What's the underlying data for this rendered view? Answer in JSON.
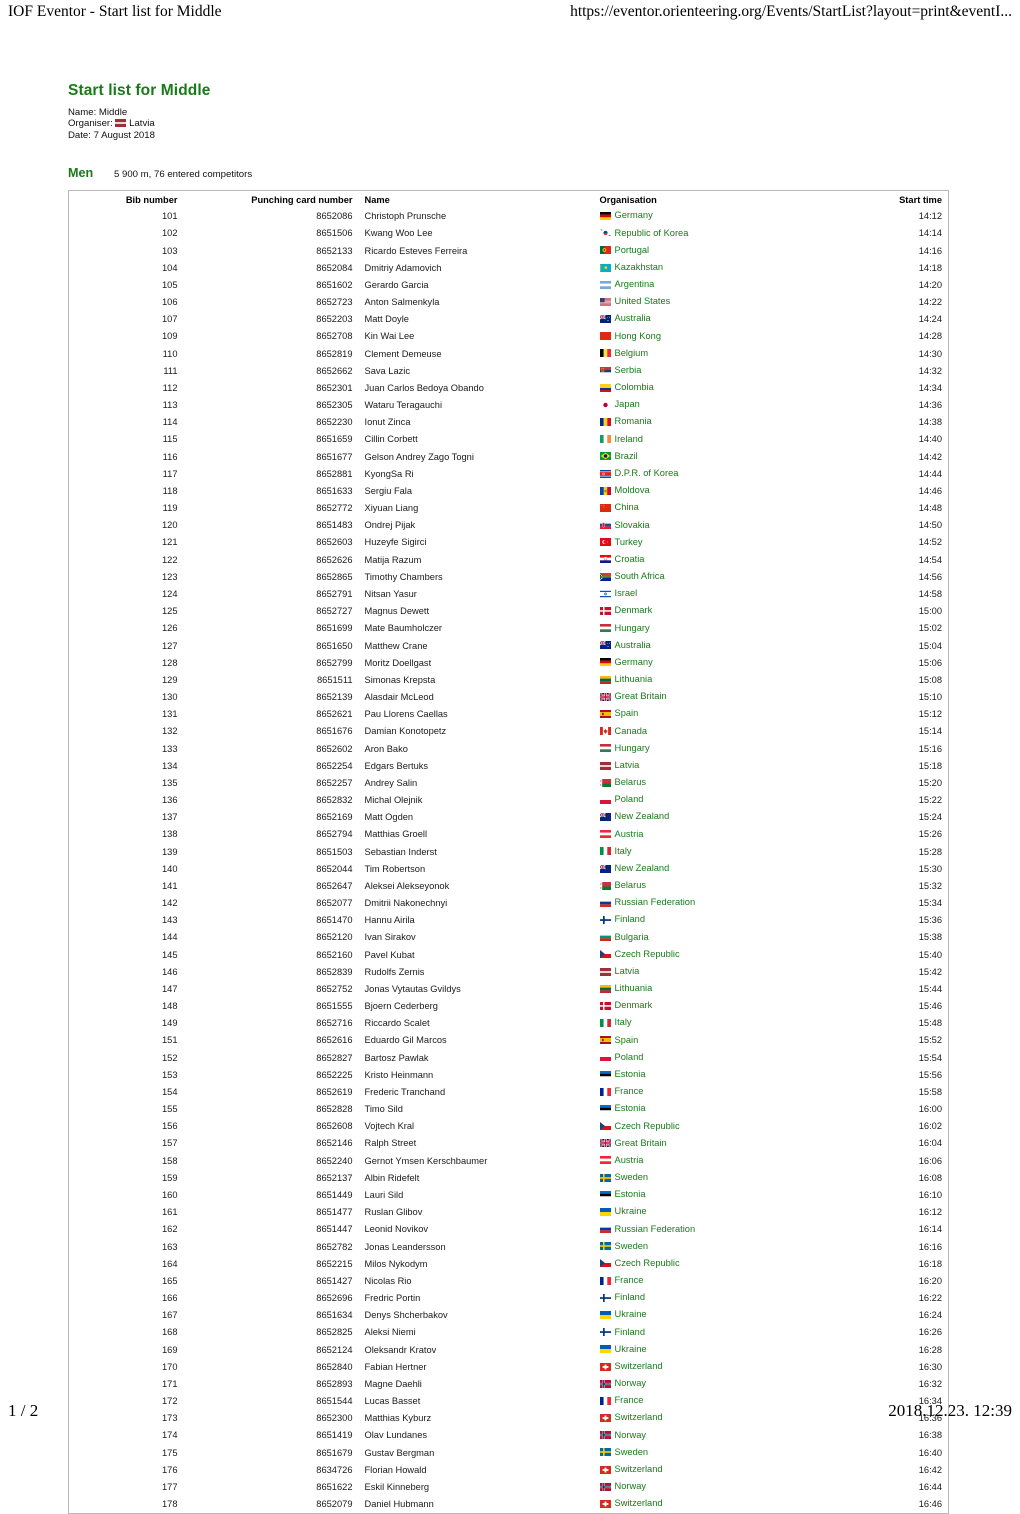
{
  "print_header": {
    "left": "IOF Eventor - Start list for Middle",
    "right": "https://eventor.orienteering.org/Events/StartList?layout=print&eventI..."
  },
  "print_footer": {
    "page": "1 / 2",
    "timestamp": "2018.12.23. 12:39"
  },
  "document": {
    "title": "Start list for Middle",
    "title_color": "#1a7a1a",
    "meta": {
      "name_label": "Name: Middle",
      "organiser_label": "Organiser:",
      "organiser_value": "Latvia",
      "organiser_flag": "flag-lv",
      "date_label": "Date: 7 August 2018"
    }
  },
  "class_block": {
    "class_name": "Men",
    "class_info": "5 900 m, 76 entered competitors"
  },
  "table": {
    "columns": [
      "Bib number",
      "Punching card number",
      "Name",
      "Organisation",
      "Start time"
    ],
    "rows": [
      {
        "bib": "101",
        "card": "8652086",
        "name": "Christoph Prunsche",
        "org": "Germany",
        "flag": "flag-de",
        "time": "14:12"
      },
      {
        "bib": "102",
        "card": "8651506",
        "name": "Kwang Woo Lee",
        "org": "Republic of Korea",
        "flag": "flag-kr",
        "time": "14:14"
      },
      {
        "bib": "103",
        "card": "8652133",
        "name": "Ricardo Esteves Ferreira",
        "org": "Portugal",
        "flag": "flag-pt",
        "time": "14:16"
      },
      {
        "bib": "104",
        "card": "8652084",
        "name": "Dmitriy Adamovich",
        "org": "Kazakhstan",
        "flag": "flag-kz",
        "time": "14:18"
      },
      {
        "bib": "105",
        "card": "8651602",
        "name": "Gerardo Garcia",
        "org": "Argentina",
        "flag": "flag-ar",
        "time": "14:20"
      },
      {
        "bib": "106",
        "card": "8652723",
        "name": "Anton Salmenkyla",
        "org": "United States",
        "flag": "flag-us",
        "time": "14:22"
      },
      {
        "bib": "107",
        "card": "8652203",
        "name": "Matt Doyle",
        "org": "Australia",
        "flag": "flag-au",
        "time": "14:24"
      },
      {
        "bib": "109",
        "card": "8652708",
        "name": "Kin Wai Lee",
        "org": "Hong Kong",
        "flag": "flag-hk",
        "time": "14:28"
      },
      {
        "bib": "110",
        "card": "8652819",
        "name": "Clement Demeuse",
        "org": "Belgium",
        "flag": "flag-be",
        "time": "14:30"
      },
      {
        "bib": "111",
        "card": "8652662",
        "name": "Sava Lazic",
        "org": "Serbia",
        "flag": "flag-rs",
        "time": "14:32"
      },
      {
        "bib": "112",
        "card": "8652301",
        "name": "Juan Carlos Bedoya Obando",
        "org": "Colombia",
        "flag": "flag-co",
        "time": "14:34"
      },
      {
        "bib": "113",
        "card": "8652305",
        "name": "Wataru Teragauchi",
        "org": "Japan",
        "flag": "flag-jp",
        "time": "14:36"
      },
      {
        "bib": "114",
        "card": "8652230",
        "name": "Ionut Zinca",
        "org": "Romania",
        "flag": "flag-ro",
        "time": "14:38"
      },
      {
        "bib": "115",
        "card": "8651659",
        "name": "Cillin Corbett",
        "org": "Ireland",
        "flag": "flag-ie",
        "time": "14:40"
      },
      {
        "bib": "116",
        "card": "8651677",
        "name": "Gelson Andrey Zago Togni",
        "org": "Brazil",
        "flag": "flag-br",
        "time": "14:42"
      },
      {
        "bib": "117",
        "card": "8652881",
        "name": "KyongSa Ri",
        "org": "D.P.R. of Korea",
        "flag": "flag-kp",
        "time": "14:44"
      },
      {
        "bib": "118",
        "card": "8651633",
        "name": "Sergiu Fala",
        "org": "Moldova",
        "flag": "flag-md",
        "time": "14:46"
      },
      {
        "bib": "119",
        "card": "8652772",
        "name": "Xiyuan Liang",
        "org": "China",
        "flag": "flag-cn",
        "time": "14:48"
      },
      {
        "bib": "120",
        "card": "8651483",
        "name": "Ondrej Pijak",
        "org": "Slovakia",
        "flag": "flag-sk",
        "time": "14:50"
      },
      {
        "bib": "121",
        "card": "8652603",
        "name": "Huzeyfe Sigirci",
        "org": "Turkey",
        "flag": "flag-tr",
        "time": "14:52"
      },
      {
        "bib": "122",
        "card": "8652626",
        "name": "Matija Razum",
        "org": "Croatia",
        "flag": "flag-hr",
        "time": "14:54"
      },
      {
        "bib": "123",
        "card": "8652865",
        "name": "Timothy Chambers",
        "org": "South Africa",
        "flag": "flag-za",
        "time": "14:56"
      },
      {
        "bib": "124",
        "card": "8652791",
        "name": "Nitsan Yasur",
        "org": "Israel",
        "flag": "flag-il",
        "time": "14:58"
      },
      {
        "bib": "125",
        "card": "8652727",
        "name": "Magnus Dewett",
        "org": "Denmark",
        "flag": "flag-dk",
        "time": "15:00"
      },
      {
        "bib": "126",
        "card": "8651699",
        "name": "Mate Baumholczer",
        "org": "Hungary",
        "flag": "flag-hu",
        "time": "15:02"
      },
      {
        "bib": "127",
        "card": "8651650",
        "name": "Matthew Crane",
        "org": "Australia",
        "flag": "flag-au",
        "time": "15:04"
      },
      {
        "bib": "128",
        "card": "8652799",
        "name": "Moritz Doellgast",
        "org": "Germany",
        "flag": "flag-de",
        "time": "15:06"
      },
      {
        "bib": "129",
        "card": "8651511",
        "name": "Simonas Krepsta",
        "org": "Lithuania",
        "flag": "flag-lt",
        "time": "15:08"
      },
      {
        "bib": "130",
        "card": "8652139",
        "name": "Alasdair McLeod",
        "org": "Great Britain",
        "flag": "flag-gb",
        "time": "15:10"
      },
      {
        "bib": "131",
        "card": "8652621",
        "name": "Pau Llorens Caellas",
        "org": "Spain",
        "flag": "flag-es",
        "time": "15:12"
      },
      {
        "bib": "132",
        "card": "8651676",
        "name": "Damian Konotopetz",
        "org": "Canada",
        "flag": "flag-ca",
        "time": "15:14"
      },
      {
        "bib": "133",
        "card": "8652602",
        "name": "Aron Bako",
        "org": "Hungary",
        "flag": "flag-hu",
        "time": "15:16"
      },
      {
        "bib": "134",
        "card": "8652254",
        "name": "Edgars Bertuks",
        "org": "Latvia",
        "flag": "flag-lv",
        "time": "15:18"
      },
      {
        "bib": "135",
        "card": "8652257",
        "name": "Andrey Salin",
        "org": "Belarus",
        "flag": "flag-by",
        "time": "15:20"
      },
      {
        "bib": "136",
        "card": "8652832",
        "name": "Michal Olejnik",
        "org": "Poland",
        "flag": "flag-pl",
        "time": "15:22"
      },
      {
        "bib": "137",
        "card": "8652169",
        "name": "Matt Ogden",
        "org": "New Zealand",
        "flag": "flag-nz",
        "time": "15:24"
      },
      {
        "bib": "138",
        "card": "8652794",
        "name": "Matthias Groell",
        "org": "Austria",
        "flag": "flag-at",
        "time": "15:26"
      },
      {
        "bib": "139",
        "card": "8651503",
        "name": "Sebastian Inderst",
        "org": "Italy",
        "flag": "flag-it",
        "time": "15:28"
      },
      {
        "bib": "140",
        "card": "8652044",
        "name": "Tim Robertson",
        "org": "New Zealand",
        "flag": "flag-nz",
        "time": "15:30"
      },
      {
        "bib": "141",
        "card": "8652647",
        "name": "Aleksei Alekseyonok",
        "org": "Belarus",
        "flag": "flag-by",
        "time": "15:32"
      },
      {
        "bib": "142",
        "card": "8652077",
        "name": "Dmitrii Nakonechnyi",
        "org": "Russian Federation",
        "flag": "flag-ru",
        "time": "15:34"
      },
      {
        "bib": "143",
        "card": "8651470",
        "name": "Hannu Airila",
        "org": "Finland",
        "flag": "flag-fi",
        "time": "15:36"
      },
      {
        "bib": "144",
        "card": "8652120",
        "name": "Ivan Sirakov",
        "org": "Bulgaria",
        "flag": "flag-bg",
        "time": "15:38"
      },
      {
        "bib": "145",
        "card": "8652160",
        "name": "Pavel Kubat",
        "org": "Czech Republic",
        "flag": "flag-cz",
        "time": "15:40"
      },
      {
        "bib": "146",
        "card": "8652839",
        "name": "Rudolfs Zernis",
        "org": "Latvia",
        "flag": "flag-lv",
        "time": "15:42"
      },
      {
        "bib": "147",
        "card": "8652752",
        "name": "Jonas Vytautas Gvildys",
        "org": "Lithuania",
        "flag": "flag-lt",
        "time": "15:44"
      },
      {
        "bib": "148",
        "card": "8651555",
        "name": "Bjoern Cederberg",
        "org": "Denmark",
        "flag": "flag-dk",
        "time": "15:46"
      },
      {
        "bib": "149",
        "card": "8652716",
        "name": "Riccardo Scalet",
        "org": "Italy",
        "flag": "flag-it",
        "time": "15:48"
      },
      {
        "bib": "151",
        "card": "8652616",
        "name": "Eduardo Gil Marcos",
        "org": "Spain",
        "flag": "flag-es",
        "time": "15:52"
      },
      {
        "bib": "152",
        "card": "8652827",
        "name": "Bartosz Pawlak",
        "org": "Poland",
        "flag": "flag-pl",
        "time": "15:54"
      },
      {
        "bib": "153",
        "card": "8652225",
        "name": "Kristo Heinmann",
        "org": "Estonia",
        "flag": "flag-ee",
        "time": "15:56"
      },
      {
        "bib": "154",
        "card": "8652619",
        "name": "Frederic Tranchand",
        "org": "France",
        "flag": "flag-fr",
        "time": "15:58"
      },
      {
        "bib": "155",
        "card": "8652828",
        "name": "Timo Sild",
        "org": "Estonia",
        "flag": "flag-ee",
        "time": "16:00"
      },
      {
        "bib": "156",
        "card": "8652608",
        "name": "Vojtech Kral",
        "org": "Czech Republic",
        "flag": "flag-cz",
        "time": "16:02"
      },
      {
        "bib": "157",
        "card": "8652146",
        "name": "Ralph Street",
        "org": "Great Britain",
        "flag": "flag-gb",
        "time": "16:04"
      },
      {
        "bib": "158",
        "card": "8652240",
        "name": "Gernot Ymsen Kerschbaumer",
        "org": "Austria",
        "flag": "flag-at",
        "time": "16:06"
      },
      {
        "bib": "159",
        "card": "8652137",
        "name": "Albin Ridefelt",
        "org": "Sweden",
        "flag": "flag-se",
        "time": "16:08"
      },
      {
        "bib": "160",
        "card": "8651449",
        "name": "Lauri Sild",
        "org": "Estonia",
        "flag": "flag-ee",
        "time": "16:10"
      },
      {
        "bib": "161",
        "card": "8651477",
        "name": "Ruslan Glibov",
        "org": "Ukraine",
        "flag": "flag-ua",
        "time": "16:12"
      },
      {
        "bib": "162",
        "card": "8651447",
        "name": "Leonid Novikov",
        "org": "Russian Federation",
        "flag": "flag-ru",
        "time": "16:14"
      },
      {
        "bib": "163",
        "card": "8652782",
        "name": "Jonas Leandersson",
        "org": "Sweden",
        "flag": "flag-se",
        "time": "16:16"
      },
      {
        "bib": "164",
        "card": "8652215",
        "name": "Milos Nykodym",
        "org": "Czech Republic",
        "flag": "flag-cz",
        "time": "16:18"
      },
      {
        "bib": "165",
        "card": "8651427",
        "name": "Nicolas Rio",
        "org": "France",
        "flag": "flag-fr",
        "time": "16:20"
      },
      {
        "bib": "166",
        "card": "8652696",
        "name": "Fredric Portin",
        "org": "Finland",
        "flag": "flag-fi",
        "time": "16:22"
      },
      {
        "bib": "167",
        "card": "8651634",
        "name": "Denys Shcherbakov",
        "org": "Ukraine",
        "flag": "flag-ua",
        "time": "16:24"
      },
      {
        "bib": "168",
        "card": "8652825",
        "name": "Aleksi Niemi",
        "org": "Finland",
        "flag": "flag-fi",
        "time": "16:26"
      },
      {
        "bib": "169",
        "card": "8652124",
        "name": "Oleksandr Kratov",
        "org": "Ukraine",
        "flag": "flag-ua",
        "time": "16:28"
      },
      {
        "bib": "170",
        "card": "8652840",
        "name": "Fabian Hertner",
        "org": "Switzerland",
        "flag": "flag-ch",
        "time": "16:30"
      },
      {
        "bib": "171",
        "card": "8652893",
        "name": "Magne Daehli",
        "org": "Norway",
        "flag": "flag-no",
        "time": "16:32"
      },
      {
        "bib": "172",
        "card": "8651544",
        "name": "Lucas Basset",
        "org": "France",
        "flag": "flag-fr",
        "time": "16:34"
      },
      {
        "bib": "173",
        "card": "8652300",
        "name": "Matthias Kyburz",
        "org": "Switzerland",
        "flag": "flag-ch",
        "time": "16:36"
      },
      {
        "bib": "174",
        "card": "8651419",
        "name": "Olav Lundanes",
        "org": "Norway",
        "flag": "flag-no",
        "time": "16:38"
      },
      {
        "bib": "175",
        "card": "8651679",
        "name": "Gustav Bergman",
        "org": "Sweden",
        "flag": "flag-se",
        "time": "16:40"
      },
      {
        "bib": "176",
        "card": "8634726",
        "name": "Florian Howald",
        "org": "Switzerland",
        "flag": "flag-ch",
        "time": "16:42"
      },
      {
        "bib": "177",
        "card": "8651622",
        "name": "Eskil Kinneberg",
        "org": "Norway",
        "flag": "flag-no",
        "time": "16:44"
      },
      {
        "bib": "178",
        "card": "8652079",
        "name": "Daniel Hubmann",
        "org": "Switzerland",
        "flag": "flag-ch",
        "time": "16:46"
      }
    ]
  }
}
